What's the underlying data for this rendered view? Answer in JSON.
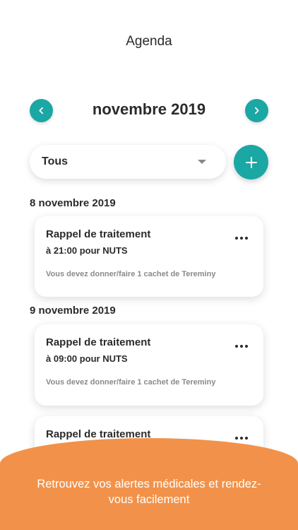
{
  "header": {
    "title": "Agenda"
  },
  "month_nav": {
    "month_label": "novembre 2019",
    "prev_icon": "chevron-left-icon",
    "next_icon": "chevron-right-icon"
  },
  "filter": {
    "selected": "Tous",
    "add_icon": "plus-icon"
  },
  "groups": [
    {
      "date": "8 novembre 2019",
      "cards": [
        {
          "title": "Rappel de traitement",
          "subtitle": "à 21:00 pour NUTS",
          "description": "Vous devez donner/faire 1 cachet de Tereminy"
        }
      ]
    },
    {
      "date": "9 novembre 2019",
      "cards": [
        {
          "title": "Rappel de traitement",
          "subtitle": "à 09:00 pour NUTS",
          "description": "Vous devez donner/faire 1 cachet de Tereminy"
        },
        {
          "title": "Rappel de traitement",
          "subtitle": "",
          "description": ""
        }
      ]
    }
  ],
  "banner": {
    "text": "Retrouvez vos alertes médicales et rendez-vous facilement"
  },
  "colors": {
    "accent": "#1ba7a4",
    "banner": "#f2924a"
  }
}
